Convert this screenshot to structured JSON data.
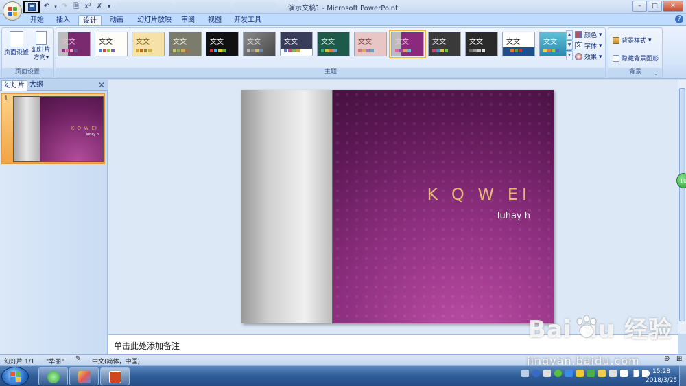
{
  "window": {
    "title": "演示文稿1 - Microsoft PowerPoint",
    "controls": {
      "minimize": "–",
      "maximize": "□",
      "close": "✕"
    }
  },
  "ribbon": {
    "tabs": [
      "开始",
      "插入",
      "设计",
      "动画",
      "幻灯片放映",
      "审阅",
      "视图",
      "开发工具"
    ],
    "active_tab": "设计",
    "groups": {
      "page_setup": {
        "label": "页面设置",
        "page_setup_btn": "页面设置",
        "orientation_btn_1": "幻灯片",
        "orientation_btn_2": "方向",
        "orientation_arrow": "▾"
      },
      "themes": {
        "label": "主题",
        "sample_text": "文文",
        "colors_btn": "颜色",
        "fonts_btn": "字体",
        "effects_btn": "效果",
        "font_icon_glyph": "文",
        "selected_index": 9
      },
      "background": {
        "label": "背景",
        "styles_btn": "背景样式",
        "hide_graphics": "隐藏背景图形"
      }
    }
  },
  "theme_gallery": [
    {
      "bg": "linear-gradient(90deg,#bcbcbc 30%,#7a2a6e 30%)",
      "fg": "#e9b7da",
      "sw": [
        "#8e2f7f",
        "#d46aa8",
        "#f2a2c7",
        "#6a4e8a"
      ]
    },
    {
      "bg": "#fffdf8",
      "fg": "#222",
      "sw": [
        "#4f81bd",
        "#c0504d",
        "#9bbb59",
        "#8064a2"
      ]
    },
    {
      "bg": "#f6e2a8",
      "fg": "#7a5a1a",
      "sw": [
        "#d5a53a",
        "#b66e2a",
        "#8f8b3a",
        "#c9b04a"
      ]
    },
    {
      "bg": "#7c7c6c",
      "fg": "#f0f0e0",
      "sw": [
        "#c2c27a",
        "#8fa96a",
        "#d1a85a",
        "#a46d4d"
      ]
    },
    {
      "bg": "#111",
      "fg": "#fff",
      "sw": [
        "#cf3a3a",
        "#4fa9d9",
        "#e8c534",
        "#66b033"
      ]
    },
    {
      "bg": "linear-gradient(135deg,#8a8a8a,#4a4a4a)",
      "fg": "#ddd",
      "sw": [
        "#b7b7b7",
        "#888",
        "#d0b87a",
        "#6e8aa6"
      ]
    },
    {
      "bg": "linear-gradient(#3a3d5a 70%,#fff 70%)",
      "fg": "#fff",
      "sw": [
        "#5a7bbd",
        "#b55a7a",
        "#7ab55a",
        "#d0a14a"
      ]
    },
    {
      "bg": "#1e5a4a",
      "fg": "#d7f0e0",
      "sw": [
        "#3fa37a",
        "#d0c24a",
        "#e07a3a",
        "#6a9fd0"
      ]
    },
    {
      "bg": "#e8c6c6",
      "fg": "#7a3a3a",
      "sw": [
        "#c97a7a",
        "#d9a66a",
        "#a37ab5",
        "#6aa3b5"
      ]
    },
    {
      "bg": "linear-gradient(90deg,#bcbcbc 30%,#8b2a7d 30%)",
      "fg": "#f3c2e6",
      "sw": [
        "#d46aa8",
        "#9a4db5",
        "#e49a5a",
        "#6ab5d4"
      ]
    },
    {
      "bg": "#3a3a3a",
      "fg": "#eee",
      "sw": [
        "#c04a6a",
        "#4a8ac0",
        "#d8c84a",
        "#7ac04a"
      ]
    },
    {
      "bg": "#2a2a2a",
      "fg": "#fff",
      "sw": [
        "#6a6a6a",
        "#9a9a9a",
        "#c8c8c8",
        "#e0e0e0"
      ]
    },
    {
      "bg": "linear-gradient(#fff 65%,#1c4f8c 65%)",
      "fg": "#111",
      "sw": [
        "#1c4f8c",
        "#e07a2a",
        "#5aa04a",
        "#c03a3a"
      ]
    },
    {
      "bg": "linear-gradient(#5fc2d8,#2a8ab0)",
      "fg": "#fff",
      "sw": [
        "#f0d04a",
        "#e07a4a",
        "#8ad04a",
        "#4a6ad0"
      ]
    }
  ],
  "left_pane": {
    "tabs": [
      "幻灯片",
      "大纲"
    ],
    "close": "✕",
    "slide_number": "1",
    "thumb_title": "K Q W EI",
    "thumb_sub": "luhay h"
  },
  "slide": {
    "title": "K Q W EI",
    "subtitle": "luhay h"
  },
  "notes": {
    "placeholder": "单击此处添加备注"
  },
  "status": {
    "slide": "幻灯片 1/1",
    "theme": "\"华丽\"",
    "language": "中文(简体，中国)",
    "zoom_plus": "⊕",
    "fit": "⊞"
  },
  "side_badge": "10",
  "taskbar": {
    "time": "15:28",
    "date": "2018/3/25"
  },
  "watermark": {
    "brand": "Bai du 经验",
    "url": "jingyan.baidu.com"
  },
  "colors": {
    "accent": "#8e2f7f",
    "ribbon": "#d5e5fa",
    "title_orange": "#e8b67a"
  }
}
